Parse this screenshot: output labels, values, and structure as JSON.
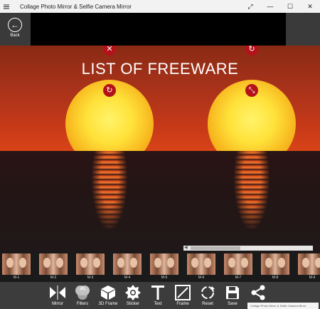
{
  "window": {
    "title": "Collage Photo Mirror & Selfie Camera Mirror",
    "minimize_glyph": "—",
    "maximize_glyph": "☐",
    "close_glyph": "✕",
    "resize_glyph": "⤢"
  },
  "header": {
    "back_label": "Back",
    "back_glyph": "←"
  },
  "canvas": {
    "overlay_text": "LIST OF FREEWARE",
    "sky_color": "#a8321a",
    "sea_color": "#231515",
    "control_color": "#b4121a"
  },
  "controls": {
    "close_glyph": "✕",
    "rotate_glyph": "↻",
    "resize_glyph": "⤡"
  },
  "thumbnails": [
    "M-1",
    "M-2",
    "M-3",
    "M-4",
    "M-5",
    "M-6",
    "M-7",
    "M-8",
    "M-9"
  ],
  "toolbar": {
    "items": [
      {
        "label": "Mirror",
        "icon": "mirror-icon"
      },
      {
        "label": "Filters",
        "icon": "filters-icon"
      },
      {
        "label": "3D Frame",
        "icon": "cube-icon"
      },
      {
        "label": "Sticker",
        "icon": "sticker-icon"
      },
      {
        "label": "Text",
        "icon": "text-icon"
      },
      {
        "label": "Frame",
        "icon": "frame-icon"
      },
      {
        "label": "Reset",
        "icon": "reset-icon"
      },
      {
        "label": "Save",
        "icon": "save-icon"
      },
      {
        "label": "",
        "icon": "share-icon"
      }
    ]
  },
  "taskbar_tooltip": "Collage Photo Mirror & Selfie Camera Mirror"
}
